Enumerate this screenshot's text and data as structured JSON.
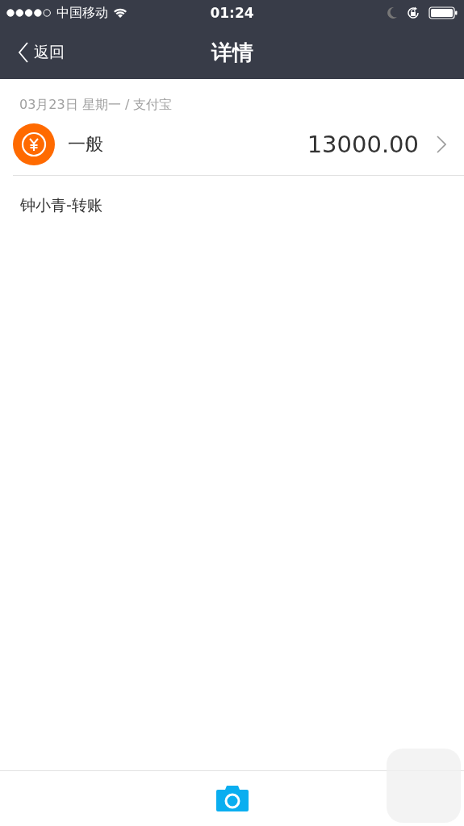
{
  "status_bar": {
    "carrier": "中国移动",
    "time": "01:24"
  },
  "nav_bar": {
    "back": "返回",
    "title": "详情"
  },
  "record": {
    "meta": "03月23日 星期一 / 支付宝",
    "category": "一般",
    "amount": "13000.00",
    "note": "钟小青-转账"
  }
}
